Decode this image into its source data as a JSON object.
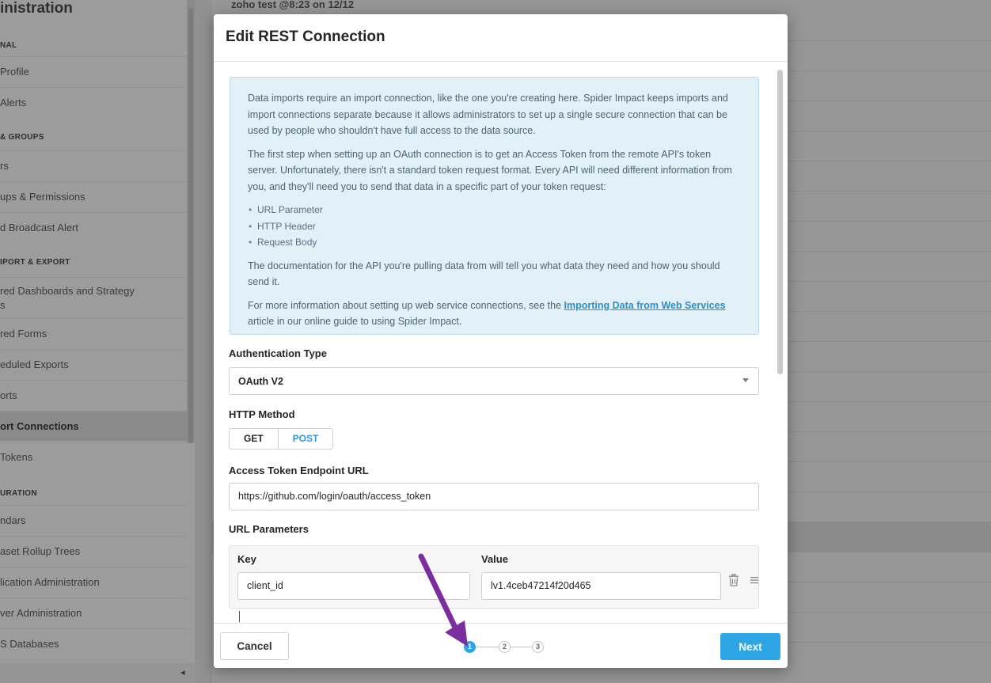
{
  "background": {
    "sidebar": {
      "title": "inistration",
      "sections": [
        {
          "label": "NAL",
          "items": [
            "Profile",
            "Alerts"
          ]
        },
        {
          "label": "& GROUPS",
          "items": [
            "rs",
            "ups & Permissions",
            "d Broadcast Alert"
          ]
        },
        {
          "label": "IPORT & EXPORT",
          "items": [
            "red Dashboards and Strategy",
            "red Forms",
            "eduled Exports",
            "orts",
            "ort Connections",
            "Tokens"
          ]
        },
        {
          "label": "URATION",
          "items": [
            "ndars",
            "aset Rollup Trees",
            "lication Administration",
            "ver Administration",
            "S Databases"
          ]
        }
      ],
      "wrap_line": "s",
      "active_item": "ort Connections",
      "collapse_glyph": "◂"
    },
    "main_row_text": "zoho test @8:23 on 12/12"
  },
  "modal": {
    "title": "Edit REST Connection",
    "info": {
      "p1": "Data imports require an import connection, like the one you're creating here. Spider Impact keeps imports and import connections separate because it allows administrators to set up a single secure connection that can be used by people who shouldn't have full access to the data source.",
      "p2": "The first step when setting up an OAuth connection is to get an Access Token from the remote API's token server. Unfortunately, there isn't a standard token request format. Every API will need different information from you, and they'll need you to send that data in a specific part of your token request:",
      "bullets": [
        "URL Parameter",
        "HTTP Header",
        "Request Body"
      ],
      "p3": "The documentation for the API you're pulling data from will tell you what data they need and how you should send it.",
      "p4_before": "For more information about setting up web service connections, see the ",
      "p4_link": "Importing Data from Web Services",
      "p4_after": " article in our online guide to using Spider Impact."
    },
    "auth_type": {
      "label": "Authentication Type",
      "value": "OAuth V2"
    },
    "http_method": {
      "label": "HTTP Method",
      "options": [
        "GET",
        "POST"
      ],
      "selected": "POST"
    },
    "endpoint": {
      "label": "Access Token Endpoint URL",
      "value": "https://github.com/login/oauth/access_token"
    },
    "url_params": {
      "label": "URL Parameters",
      "key_header": "Key",
      "value_header": "Value",
      "rows": [
        {
          "key": "client_id",
          "value": "lv1.4ceb47214f20d465"
        }
      ]
    },
    "footer": {
      "cancel_label": "Cancel",
      "next_label": "Next",
      "steps": [
        "1",
        "2",
        "3"
      ],
      "current_step": 1
    }
  },
  "annotation": {
    "arrow_color": "#7b2f9e"
  }
}
